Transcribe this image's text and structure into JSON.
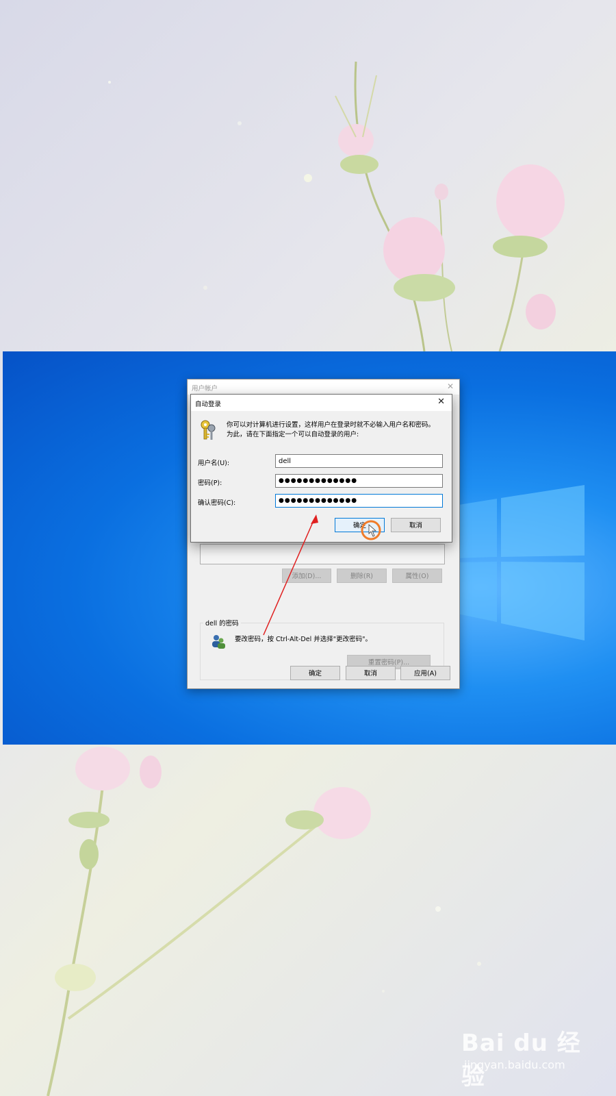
{
  "parent_window": {
    "title": "用户帐户",
    "add_label": "添加(D)...",
    "delete_label": "删除(R)",
    "properties_label": "属性(O)",
    "group_label": "dell 的密码",
    "group_text": "要改密码，按 Ctrl-Alt-Del 并选择\"更改密码\"。",
    "reset_label": "重置密码(P)...",
    "ok_label": "确定",
    "cancel_label": "取消",
    "apply_label": "应用(A)"
  },
  "dialog": {
    "title": "自动登录",
    "desc_line1": "你可以对计算机进行设置，这样用户在登录时就不必输入用户名和密码。",
    "desc_line2": "为此，请在下面指定一个可以自动登录的用户:",
    "username_label": "用户名(U):",
    "username_value": "dell",
    "password_label": "密码(P):",
    "password_value": "●●●●●●●●●●●●●",
    "confirm_label": "确认密码(C):",
    "confirm_value": "●●●●●●●●●●●●●",
    "ok_label": "确定",
    "cancel_label": "取消"
  },
  "watermark": {
    "brand": "Bai du 经验",
    "url": "jingyan.baidu.com"
  },
  "colors": {
    "desktop_blue": "#0a6fe0",
    "annotation_red": "#e02020",
    "annotation_orange": "#f07c2a",
    "focus_blue": "#0078d7"
  }
}
